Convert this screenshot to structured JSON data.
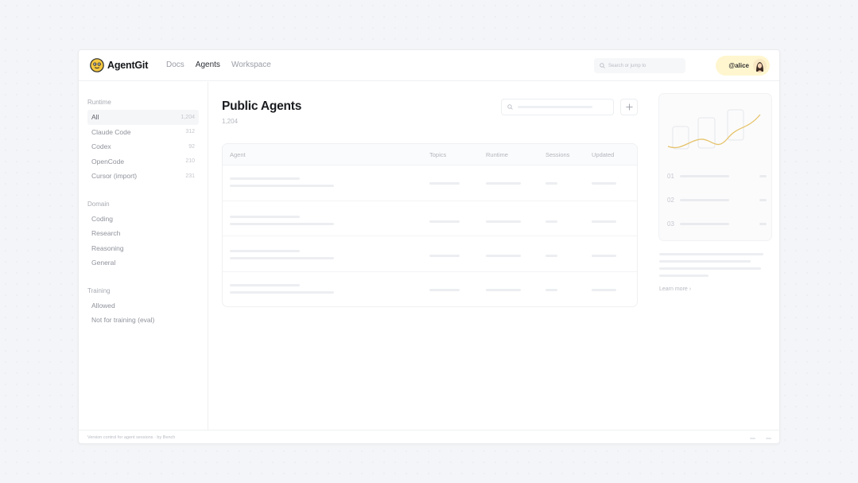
{
  "app": {
    "name": "AgentGit"
  },
  "nav": {
    "items": [
      "Docs",
      "Agents",
      "Workspace"
    ],
    "active": "Agents"
  },
  "search": {
    "placeholder": "Search or jump to"
  },
  "user": {
    "handle": "@alice"
  },
  "sidebar": {
    "groups": [
      {
        "title": "Runtime",
        "items": [
          {
            "label": "All",
            "count": "1,204",
            "active": true
          },
          {
            "label": "Claude Code",
            "count": "312"
          },
          {
            "label": "Codex",
            "count": "92"
          },
          {
            "label": "OpenCode",
            "count": "210"
          },
          {
            "label": "Cursor (import)",
            "count": "231"
          }
        ]
      },
      {
        "title": "Domain",
        "items": [
          {
            "label": "Coding"
          },
          {
            "label": "Research"
          },
          {
            "label": "Reasoning"
          },
          {
            "label": "General"
          }
        ]
      },
      {
        "title": "Training",
        "items": [
          {
            "label": "Allowed"
          },
          {
            "label": "Not for training (eval)"
          }
        ]
      }
    ]
  },
  "main": {
    "title": "Public Agents",
    "count": "1,204",
    "table": {
      "columns": [
        "Agent",
        "Topics",
        "Runtime",
        "Sessions",
        "Updated"
      ]
    }
  },
  "right": {
    "steps": [
      "01",
      "02",
      "03"
    ],
    "learn_more": "Learn more ›"
  },
  "footer": {
    "text": "Version control for agent sessions · by Bench"
  },
  "colors": {
    "accent": "#f5c842",
    "chart_line": "#e6c36a"
  }
}
